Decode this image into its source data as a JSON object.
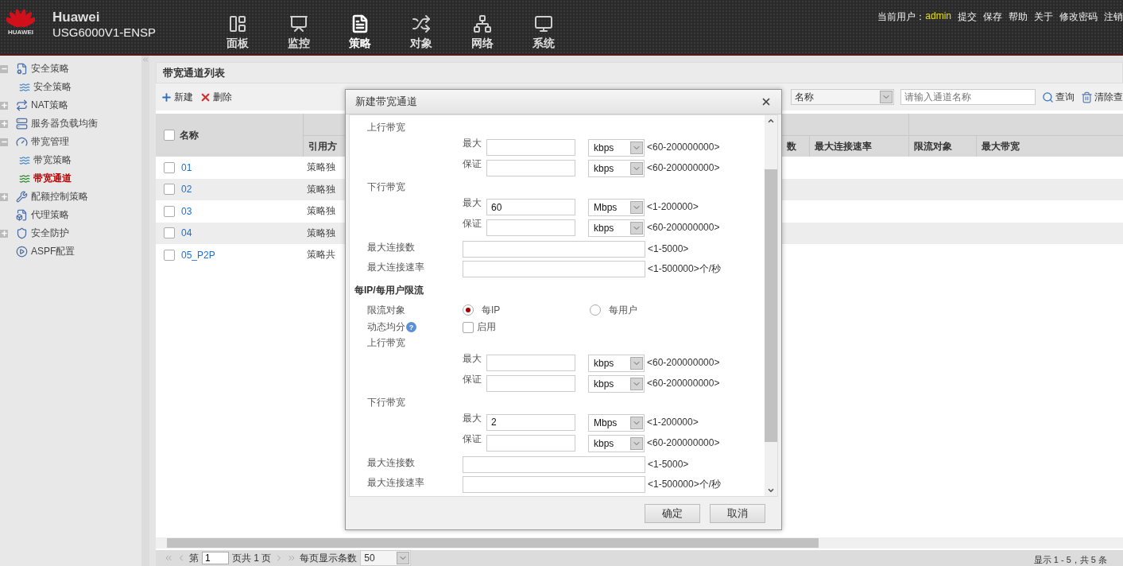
{
  "header": {
    "brand": "HUAWEI",
    "product_title": "Huawei",
    "product_model": "USG6000V1-ENSP",
    "nav": [
      {
        "label": "面板",
        "selected": false
      },
      {
        "label": "监控",
        "selected": false
      },
      {
        "label": "策略",
        "selected": true
      },
      {
        "label": "对象",
        "selected": false
      },
      {
        "label": "网络",
        "selected": false
      },
      {
        "label": "系统",
        "selected": false
      }
    ],
    "user_label": "当前用户：",
    "user": "admin",
    "links": [
      "提交",
      "保存",
      "帮助",
      "关于",
      "修改密码",
      "注销"
    ]
  },
  "sidebar": {
    "items": [
      {
        "label": "安全策略",
        "kind": "folder",
        "expanded": true,
        "children": [
          {
            "label": "安全策略",
            "selected": false
          }
        ]
      },
      {
        "label": "NAT策略",
        "kind": "folder",
        "expanded": false
      },
      {
        "label": "服务器负载均衡",
        "kind": "folder",
        "expanded": false
      },
      {
        "label": "带宽管理",
        "kind": "folder",
        "expanded": true,
        "children": [
          {
            "label": "带宽策略",
            "selected": false
          },
          {
            "label": "带宽通道",
            "selected": true
          }
        ]
      },
      {
        "label": "配额控制策略",
        "kind": "folder",
        "expanded": false
      },
      {
        "label": "代理策略",
        "kind": "item"
      },
      {
        "label": "安全防护",
        "kind": "folder",
        "expanded": false
      },
      {
        "label": "ASPF配置",
        "kind": "item"
      }
    ]
  },
  "panel": {
    "title": "带宽通道列表",
    "toolbar": {
      "new": "新建",
      "delete": "删除",
      "filter_field": "名称",
      "search": {
        "placeholder": "请输入通道名称"
      },
      "query": "查询",
      "clear": "清除查"
    },
    "table": {
      "select_all_checked": false,
      "columns": [
        "名称",
        "引用方",
        "数",
        "最大连接速率",
        "限流对象",
        "最大带宽"
      ],
      "rows": [
        {
          "name": "01",
          "reference": "策略独",
          "checked": false
        },
        {
          "name": "02",
          "reference": "策略独",
          "checked": false
        },
        {
          "name": "03",
          "reference": "策略独",
          "checked": false
        },
        {
          "name": "04",
          "reference": "策略独",
          "checked": false
        },
        {
          "name": "05_P2P",
          "reference": "策略共",
          "checked": false
        }
      ]
    },
    "pagination": {
      "page_prefix": "第",
      "page": "1",
      "page_suffix": "页共 1 页",
      "per_page_label": "每页显示条数",
      "per_page": "50",
      "summary": "显示 1 - 5，共 5 条"
    }
  },
  "dialog": {
    "title": "新建带宽通道",
    "channel": {
      "bandwidth": [
        {
          "title": "上行带宽",
          "rows": [
            {
              "label": "最大",
              "unit": "kbps",
              "range": "<60-200000000>"
            },
            {
              "label": "保证",
              "unit": "kbps",
              "range": "<60-200000000>"
            }
          ]
        },
        {
          "title": "下行带宽",
          "rows": [
            {
              "label": "最大",
              "value": "60",
              "unit": "Mbps",
              "range": "<1-200000>"
            },
            {
              "label": "保证",
              "unit": "kbps",
              "range": "<60-200000000>"
            }
          ]
        }
      ],
      "limits": [
        {
          "label": "最大连接数",
          "range": "<1-5000>"
        },
        {
          "label": "最大连接速率",
          "range": "<1-500000>个/秒"
        }
      ]
    },
    "per_ip": {
      "title": "每IP/每用户限流",
      "target": {
        "label": "限流对象",
        "options": [
          {
            "label": "每IP",
            "selected": true
          },
          {
            "label": "每用户",
            "selected": false
          }
        ]
      },
      "dynamic": {
        "label": "动态均分",
        "help": "?",
        "option": "启用",
        "checked": false
      },
      "bandwidth": [
        {
          "title": "上行带宽",
          "rows": [
            {
              "label": "最大",
              "unit": "kbps",
              "range": "<60-200000000>"
            },
            {
              "label": "保证",
              "unit": "kbps",
              "range": "<60-200000000>"
            }
          ]
        },
        {
          "title": "下行带宽",
          "rows": [
            {
              "label": "最大",
              "value": "2",
              "unit": "Mbps",
              "range": "<1-200000>"
            },
            {
              "label": "保证",
              "unit": "kbps",
              "range": "<60-200000000>"
            }
          ]
        }
      ],
      "limits": [
        {
          "label": "最大连接数",
          "range": "<1-5000>"
        },
        {
          "label": "最大连接速率",
          "range": "<1-500000>个/秒"
        }
      ]
    },
    "buttons": [
      "确定",
      "取消"
    ]
  }
}
